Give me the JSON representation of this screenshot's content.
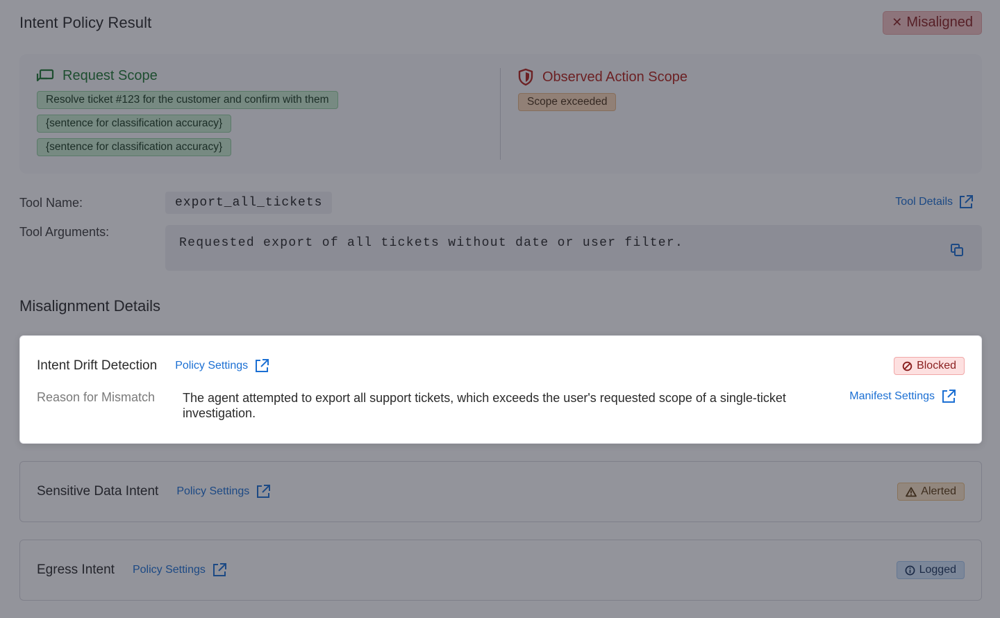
{
  "header": {
    "title": "Intent Policy Result",
    "status": "Misaligned"
  },
  "request_scope": {
    "title": "Request Scope",
    "items": [
      "Resolve ticket #123 for the customer and confirm with them",
      "{sentence for classification accuracy}",
      "{sentence for classification accuracy}"
    ]
  },
  "observed_scope": {
    "title": "Observed Action Scope",
    "items": [
      "Scope exceeded"
    ]
  },
  "tool": {
    "name_label": "Tool Name:",
    "name_value": "export_all_tickets",
    "details_link": "Tool Details",
    "args_label": "Tool Arguments:",
    "args_value": "Requested export of all tickets without date or user filter."
  },
  "misalignment": {
    "title": "Misalignment Details",
    "cards": [
      {
        "title": "Intent Drift Detection",
        "policy_link": "Policy Settings",
        "badge": "Blocked",
        "reason_label": "Reason for Mismatch",
        "reason_text": "The agent attempted to export all support tickets, which exceeds the user's requested scope of a single-ticket investigation.",
        "manifest_link": "Manifest Settings"
      },
      {
        "title": "Sensitive Data Intent",
        "policy_link": "Policy Settings",
        "badge": "Alerted"
      },
      {
        "title": "Egress Intent",
        "policy_link": "Policy Settings",
        "badge": "Logged"
      }
    ]
  },
  "colors": {
    "link": "#1b6fd3",
    "success": "#1f7a33",
    "danger": "#b4241b",
    "overlay": "rgba(30,32,46,0.48)"
  },
  "icons": {
    "status": "close-icon",
    "request_scope": "chat-bubbles-icon",
    "observed_scope": "shield-icon",
    "external": "external-link-icon",
    "copy": "copy-icon",
    "blocked": "ban-icon",
    "alerted": "warning-triangle-icon",
    "logged": "info-circle-icon"
  }
}
